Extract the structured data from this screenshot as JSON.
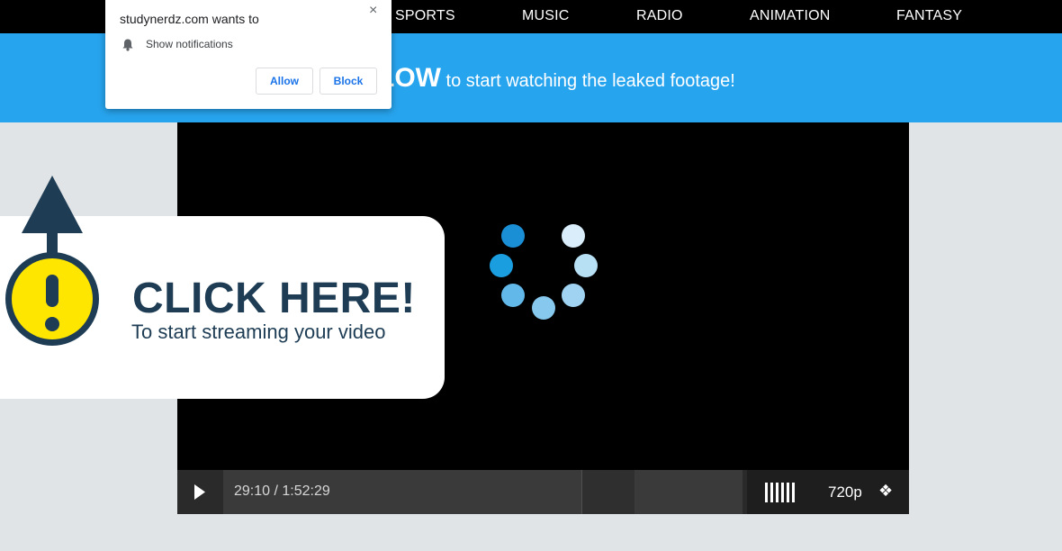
{
  "nav": {
    "items": [
      "SPORTS",
      "MUSIC",
      "RADIO",
      "ANIMATION",
      "FANTASY"
    ]
  },
  "banner": {
    "bold": "LOW",
    "rest": " to start watching the leaked footage!"
  },
  "popup": {
    "title": "studynerdz.com wants to",
    "permission": "Show notifications",
    "allow": "Allow",
    "block": "Block",
    "close": "×"
  },
  "card": {
    "title": "CLICK HERE!",
    "subtitle": "To start streaming your video"
  },
  "player": {
    "time": "29:10 / 1:52:29",
    "quality": "720p",
    "fullscreen_glyph": "❖"
  },
  "colors": {
    "banner": "#27a4ee",
    "navy": "#1e3d55",
    "warning_yellow": "#ffe600",
    "link_blue": "#1a73e8"
  },
  "icons": {
    "play": "play-icon",
    "bell": "bell-icon",
    "close": "close-icon",
    "warning": "exclamation-arrow-icon",
    "fullscreen": "fullscreen-icon"
  }
}
